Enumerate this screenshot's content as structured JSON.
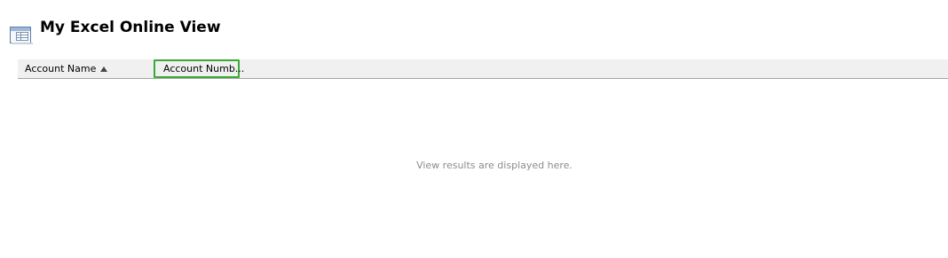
{
  "header": {
    "title": "My Excel Online View",
    "icon": "view-icon"
  },
  "grid": {
    "columns": [
      {
        "label": "Account Name",
        "sort": "ascending"
      },
      {
        "label": "Account Numb...",
        "sort": "none",
        "selected": true
      }
    ],
    "empty_message": "View results are displayed here."
  },
  "colors": {
    "selection_border": "#3aaa35",
    "header_background": "#f0f0f0",
    "empty_text": "#8c8c8c"
  }
}
